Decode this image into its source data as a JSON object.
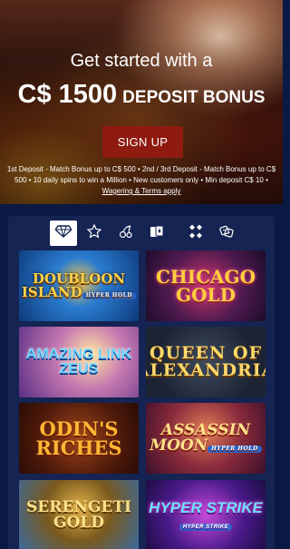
{
  "hero": {
    "headline": "Get started with a",
    "amount": "C$ 1500",
    "bonus_label": "DEPOSIT BONUS",
    "cta_label": "SIGN UP",
    "terms_text": "1st Deposit - Match Bonus up to C$ 500 • 2nd / 3rd Deposit - Match Bonus up to C$ 500 • 10 daily spins to win a Million • New customers only • Min deposit C$ 10 • ",
    "terms_link": "Wagering & Terms apply"
  },
  "tabs": [
    {
      "icon": "diamond-icon",
      "active": true
    },
    {
      "icon": "star-icon",
      "active": false
    },
    {
      "icon": "cherry-icon",
      "active": false
    },
    {
      "icon": "cards-icon",
      "active": false
    },
    {
      "icon": "dice-icon",
      "active": false
    },
    {
      "icon": "chip-icon",
      "active": false
    }
  ],
  "games": [
    {
      "name": "DOUBLOON ISLAND",
      "sub": "HYPER HOLD"
    },
    {
      "name": "CHICAGO GOLD",
      "sub": ""
    },
    {
      "name": "AMAZING LINK ZEUS",
      "sub": ""
    },
    {
      "name": "QUEEN OF ALEXANDRIA",
      "sub": ""
    },
    {
      "name": "ODIN'S RICHES",
      "sub": ""
    },
    {
      "name": "ASSASSIN MOON",
      "sub": "HYPER HOLD"
    },
    {
      "name": "SERENGETI GOLD",
      "sub": ""
    },
    {
      "name": "HYPER STRIKE",
      "sub": "HYPER STRIKE"
    }
  ]
}
